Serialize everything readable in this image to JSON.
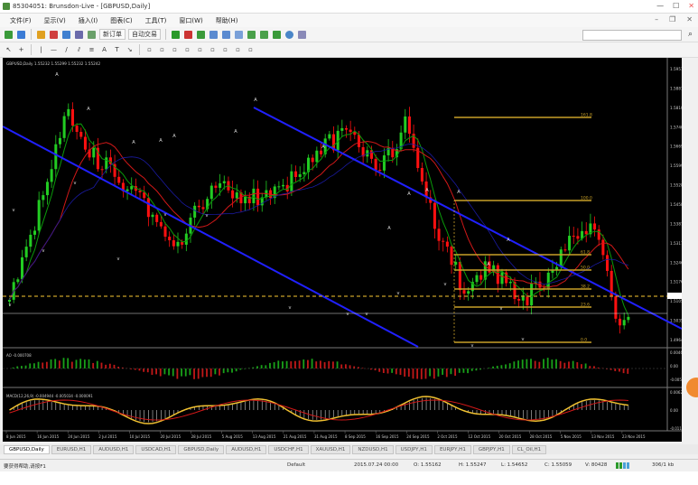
{
  "window": {
    "title": "85304051: Brunsdon-Live - [GBPUSD,Daily]"
  },
  "menu": [
    "文件(F)",
    "显示(V)",
    "插入(I)",
    "图表(C)",
    "工具(T)",
    "窗口(W)",
    "帮助(H)"
  ],
  "toolbar": {
    "new_order": "新订单",
    "auto_trading": "自动交易"
  },
  "chart": {
    "header": "GBPUSD,Daily  1.55232 1.55299 1.55232 1.55242",
    "fib_levels": [
      "161.8",
      "100.0",
      "61.8",
      "50.0",
      "38.2",
      "23.6",
      "0.0"
    ],
    "price_labels": [
      "1.59515",
      "1.58810",
      "1.58105",
      "1.57400",
      "1.56695",
      "1.55990",
      "1.55285",
      "1.54580",
      "1.53875",
      "1.53170",
      "1.52465",
      "1.51760",
      "1.51055",
      "1.50350",
      "1.49645"
    ],
    "date_labels": [
      "8 Jun 2015",
      "16 Jun 2015",
      "24 Jun 2015",
      "2 Jul 2015",
      "10 Jul 2015",
      "20 Jul 2015",
      "28 Jul 2015",
      "5 Aug 2015",
      "13 Aug 2015",
      "21 Aug 2015",
      "31 Aug 2015",
      "8 Sep 2015",
      "16 Sep 2015",
      "24 Sep 2015",
      "2 Oct 2015",
      "12 Oct 2015",
      "20 Oct 2015",
      "28 Oct 2015",
      "5 Nov 2015",
      "13 Nov 2015",
      "23 Nov 2015"
    ],
    "ao_label": "AO -0.000708",
    "macd_label": "MACD(12,26,9) -0.004944 -0.005034 -0.000091",
    "ao_scale": [
      "0.004643",
      "0.00",
      "-0.005153"
    ],
    "macd_scale": [
      "0.006213",
      "0.00",
      "-0.011566"
    ]
  },
  "tabs": [
    "GBPUSD,Daily",
    "EURUSD,H1",
    "AUDUSD,H1",
    "USDCAD,H1",
    "GBPUSD,Daily",
    "AUDUSD,H1",
    "USDCHF,H1",
    "XAUUSD,H1",
    "NZDUSD,H1",
    "USDJPY,H1",
    "EURJPY,H1",
    "GBPJPY,H1",
    "CL_Oil,H1"
  ],
  "status": {
    "help": "要获得帮助,请按F1",
    "profile": "Default",
    "datetime": "2015.07.24 00:00",
    "open": "O: 1.55162",
    "high": "H: 1.55247",
    "low": "L: 1.54652",
    "close": "C: 1.55059",
    "volume": "V: 80428",
    "traffic": "306/1 kb"
  },
  "colors": {
    "bull": "#22cc22",
    "bear": "#ff1010",
    "channel": "#2020ff",
    "fib": "#c8a028",
    "ma_red": "#d01818",
    "ma_green": "#0a9a0a",
    "macd_yellow": "#f0c030"
  }
}
